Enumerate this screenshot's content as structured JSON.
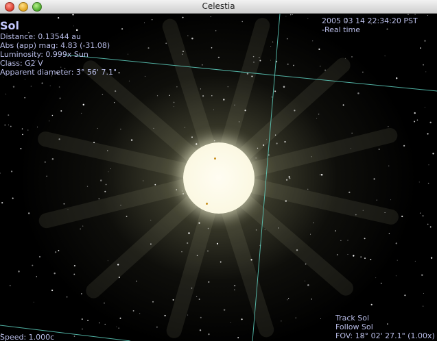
{
  "window": {
    "title": "Celestia"
  },
  "object": {
    "name": "Sol",
    "distance": "Distance: 0.13544 au",
    "magnitude": "Abs (app) mag: 4.83 (-31.08)",
    "luminosity": "Luminosity: 0.999x Sun",
    "class": "Class: G2 V",
    "apparent_diameter": "Apparent diameter: 3° 56' 7.1\""
  },
  "time": {
    "datetime": "2005 03 14 22:34:20 PST",
    "rate": "-Real time"
  },
  "camera": {
    "track": "Track Sol",
    "follow": "Follow Sol",
    "fov": "FOV: 18° 02' 27.1\" (1.00x)"
  },
  "status": {
    "speed": "Speed: 1.000c"
  },
  "colors": {
    "hud_text": "#b9bde8",
    "grid_line": "#5fd0c0",
    "sun": "#fbf8e2",
    "sunspot": "#c89020"
  }
}
